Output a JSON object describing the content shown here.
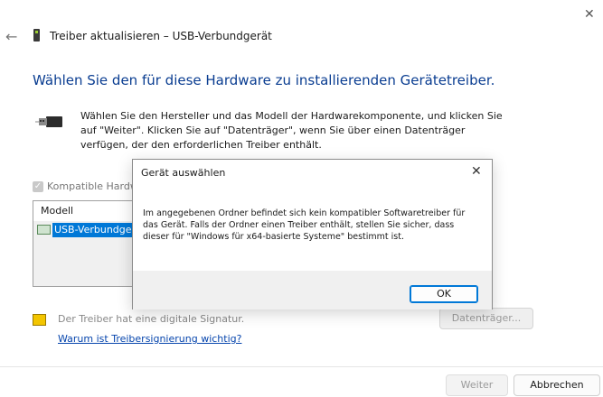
{
  "window": {
    "title": "Treiber aktualisieren – USB-Verbundgerät",
    "close_glyph": "✕",
    "back_glyph": "←"
  },
  "wizard": {
    "heading": "Wählen Sie den für diese Hardware zu installierenden Gerätetreiber.",
    "description": "Wählen Sie den Hersteller und das Modell der Hardwarekomponente, und klicken Sie auf \"Weiter\". Klicken Sie auf \"Datenträger\", wenn Sie über einen Datenträger verfügen, der den erforderlichen Treiber enthält.",
    "compat_checkbox_label": "Kompatible Hardware",
    "compat_checked": true,
    "model_list": {
      "header": "Modell",
      "items": [
        {
          "label": "USB-Verbundgerät",
          "selected": true
        }
      ]
    },
    "signature_text": "Der Treiber hat eine digitale Signatur.",
    "signature_link": "Warum ist Treibersignierung wichtig?",
    "media_button": "Datenträger...",
    "next_button": "Weiter",
    "cancel_button": "Abbrechen"
  },
  "dialog": {
    "title": "Gerät auswählen",
    "close_glyph": "✕",
    "message": "Im angegebenen Ordner befindet sich kein kompatibler Softwaretreiber für das Gerät. Falls der Ordner einen Treiber enthält, stellen Sie sicher, dass dieser für \"Windows für x64-basierte Systeme\" bestimmt ist.",
    "ok_button": "OK"
  },
  "colors": {
    "heading": "#0a3d91",
    "selection": "#0078d7",
    "link": "#0645ad"
  }
}
